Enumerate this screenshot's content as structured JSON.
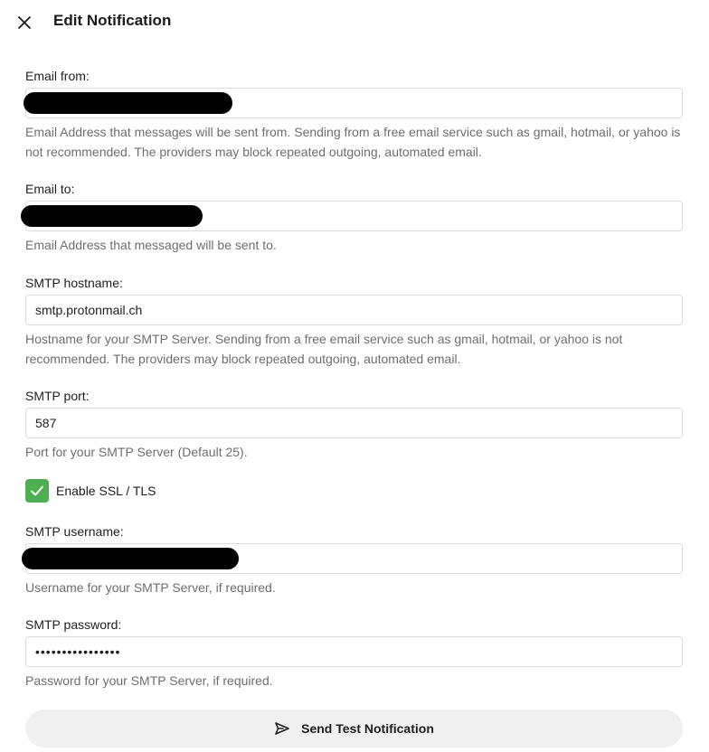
{
  "header": {
    "close_icon": "close-icon",
    "title": "Edit Notification"
  },
  "fields": {
    "email_from": {
      "label": "Email from:",
      "value": "",
      "redacted": true,
      "help": "Email Address that messages will be sent from. Sending from a free email service such as gmail, hotmail, or yahoo is not recommended. The providers may block repeated outgoing, automated email."
    },
    "email_to": {
      "label": "Email to:",
      "value": "",
      "redacted": true,
      "help": "Email Address that messaged will be sent to."
    },
    "smtp_hostname": {
      "label": "SMTP hostname:",
      "value": "smtp.protonmail.ch",
      "help": "Hostname for your SMTP Server. Sending from a free email service such as gmail, hotmail, or yahoo is not recommended. The providers may block repeated outgoing, automated email."
    },
    "smtp_port": {
      "label": "SMTP port:",
      "value": "587",
      "help": "Port for your SMTP Server (Default 25)."
    },
    "enable_ssl": {
      "label": "Enable SSL / TLS",
      "checked": true,
      "color": "#4caf50"
    },
    "smtp_username": {
      "label": "SMTP username:",
      "value": "",
      "redacted": true,
      "help": "Username for your SMTP Server, if required."
    },
    "smtp_password": {
      "label": "SMTP password:",
      "value": "••••••••••••••••",
      "help": "Password for your SMTP Server, if required."
    }
  },
  "test_button": {
    "icon": "send-icon",
    "label": "Send Test Notification"
  }
}
